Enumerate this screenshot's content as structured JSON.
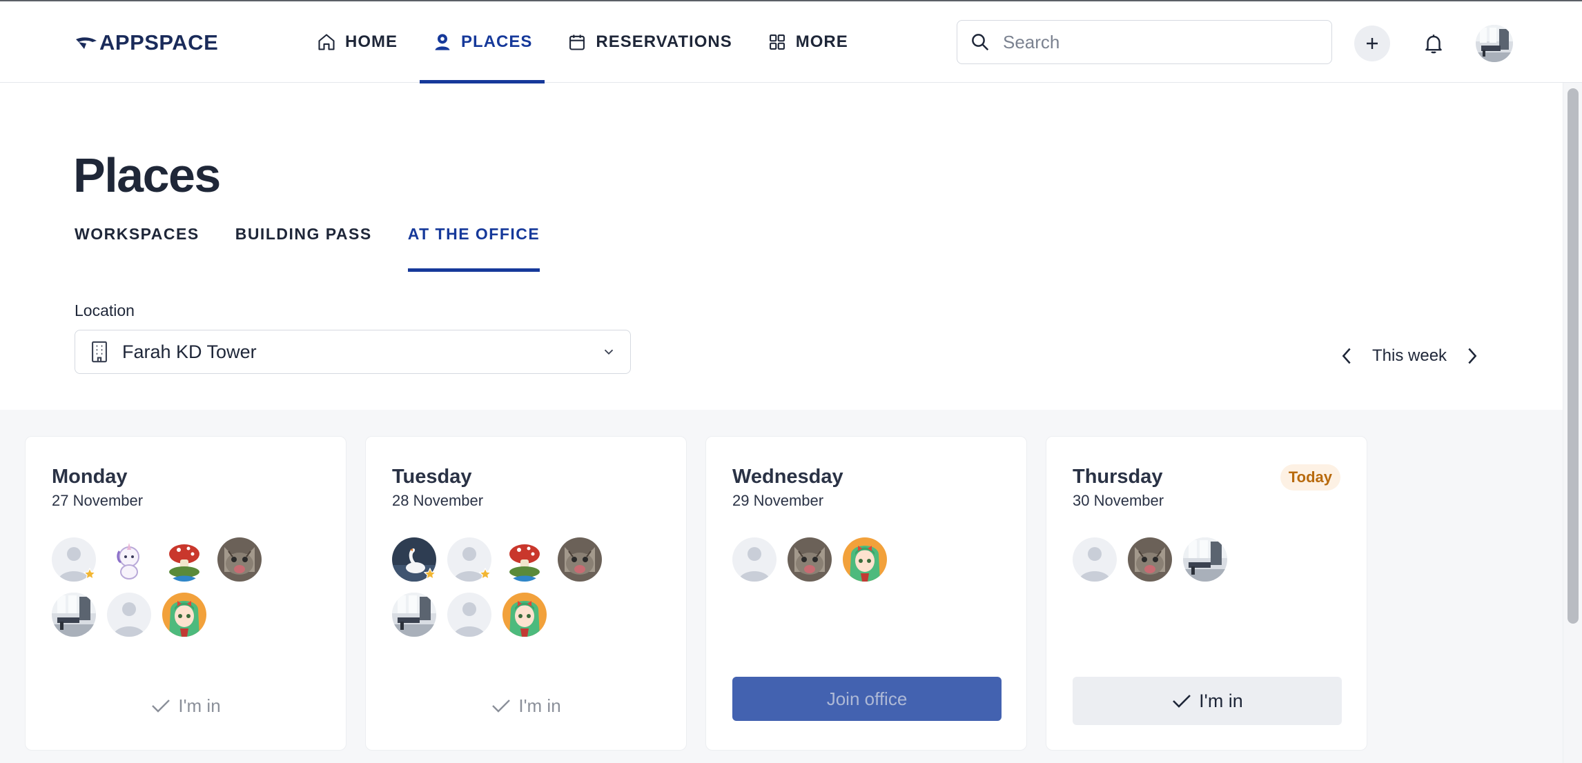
{
  "header": {
    "logo_text": "APPSPACE",
    "nav": [
      {
        "label": "HOME",
        "icon": "home-icon"
      },
      {
        "label": "PLACES",
        "icon": "person-pin-icon",
        "active": true
      },
      {
        "label": "RESERVATIONS",
        "icon": "calendar-icon"
      },
      {
        "label": "MORE",
        "icon": "grid-icon"
      }
    ],
    "search_placeholder": "Search"
  },
  "page": {
    "title": "Places",
    "tabs": [
      {
        "label": "WORKSPACES"
      },
      {
        "label": "BUILDING PASS"
      },
      {
        "label": "AT THE OFFICE",
        "active": true
      }
    ],
    "location_label": "Location",
    "location_value": "Farah KD Tower",
    "week_label": "This week"
  },
  "days": [
    {
      "day": "Monday",
      "date": "27 November",
      "action": "I'm in"
    },
    {
      "day": "Tuesday",
      "date": "28 November",
      "action": "I'm in"
    },
    {
      "day": "Wednesday",
      "date": "29 November",
      "action": "Join office"
    },
    {
      "day": "Thursday",
      "date": "30 November",
      "action": "I'm in",
      "badge": "Today"
    }
  ],
  "colors": {
    "primary": "#16399a",
    "join_button": "#4362b0",
    "today_badge_bg": "#fdf1e4",
    "today_badge_text": "#b86a0d",
    "favorite_star": "#f2b632"
  }
}
